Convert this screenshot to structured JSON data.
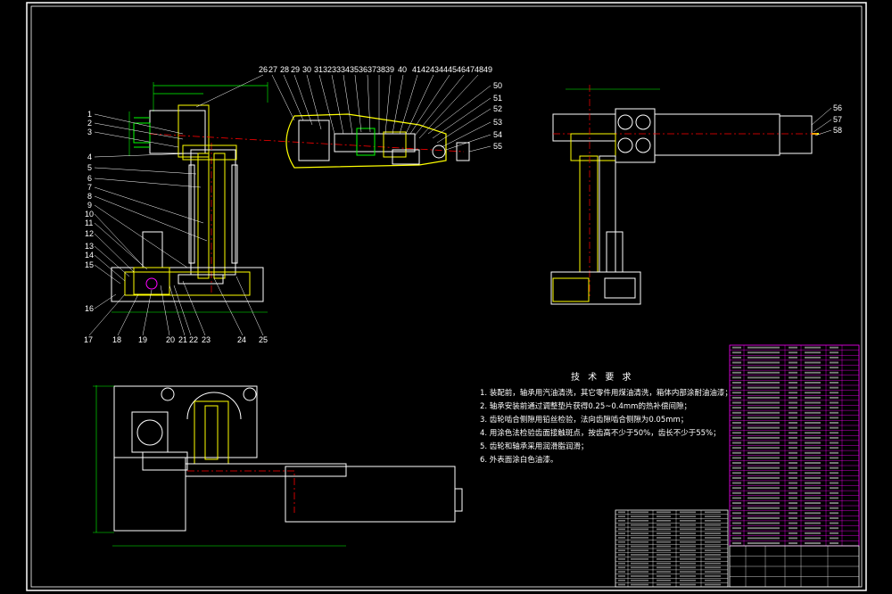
{
  "colors": {
    "background": "#000000",
    "frame": "#ffffff",
    "yellow_parts": "#ffff00",
    "red_axis": "#ff0000",
    "magenta_table": "#ff00ff",
    "green_dims": "#00ff00",
    "leaders": "#ffffff"
  },
  "front_view": {
    "labels_left": [
      "1",
      "2",
      "3",
      "4",
      "5",
      "6",
      "7",
      "8",
      "9",
      "10",
      "11",
      "12",
      "13",
      "14",
      "15",
      "16"
    ],
    "labels_bottom": [
      "17",
      "18",
      "19",
      "20",
      "21",
      "22",
      "23",
      "24",
      "25"
    ],
    "labels_top": [
      "26",
      "27",
      "28",
      "29",
      "30",
      "31",
      "32",
      "33",
      "34",
      "35",
      "36",
      "37",
      "38",
      "39",
      "40",
      "41",
      "42",
      "43",
      "44",
      "45",
      "46",
      "47",
      "48",
      "49"
    ],
    "labels_right": [
      "50",
      "51",
      "52",
      "53",
      "54",
      "55"
    ]
  },
  "side_view": {
    "labels_right": [
      "56",
      "57",
      "58"
    ]
  },
  "notes": {
    "title": "技 术 要 求",
    "items": [
      "1. 装配前，轴承用汽油清洗，其它零件用煤油清洗，箱体内部涂耐油油漆；",
      "2. 轴承安装前通过调整垫片获得0.25~0.4mm的热补偿间隙；",
      "3. 齿轮啮合侧隙用铅丝检验，法向齿隙啮合侧隙为0.05mm；",
      "4. 用涂色法检验齿面接触斑点，按齿高不少于50%，齿长不少于55%；",
      "5. 齿轮和轴承采用润滑脂润滑；",
      "6. 外表面涂白色油漆。"
    ]
  }
}
